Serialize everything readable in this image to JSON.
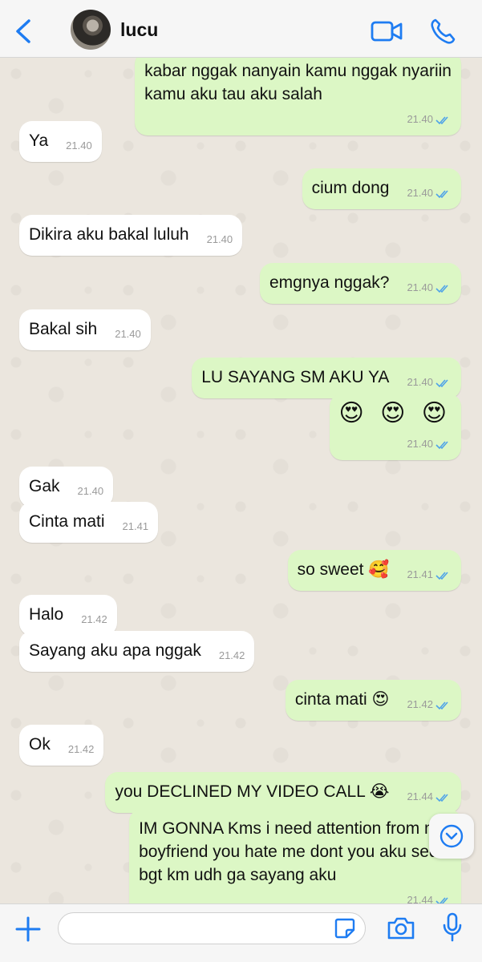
{
  "header": {
    "contact_name": "lucu",
    "back_icon": "chevron-left-icon",
    "video_icon": "video-camera-icon",
    "call_icon": "phone-icon"
  },
  "colors": {
    "accent": "#1e7cf2",
    "outgoing_bubble": "#dcf7c5",
    "incoming_bubble": "#ffffff",
    "read_ticks": "#4fa3e8"
  },
  "messages": [
    {
      "dir": "out",
      "lines": [
        "kabar nggak nanyain kamu nggak nyariin",
        "kamu aku tau aku salah"
      ],
      "time": "21.40",
      "read": true
    },
    {
      "dir": "in",
      "text": "Ya",
      "time": "21.40"
    },
    {
      "dir": "out",
      "text": "cium dong",
      "time": "21.40",
      "read": true
    },
    {
      "dir": "in",
      "text": "Dikira aku bakal luluh",
      "time": "21.40"
    },
    {
      "dir": "out",
      "text": "emgnya nggak?",
      "time": "21.40",
      "read": true
    },
    {
      "dir": "in",
      "text": "Bakal sih",
      "time": "21.40"
    },
    {
      "dir": "out",
      "text": "LU SAYANG SM AKU YA",
      "time": "21.40",
      "read": true
    },
    {
      "dir": "out",
      "text": "😍 😍 😍",
      "time": "21.40",
      "read": true
    },
    {
      "dir": "in",
      "text": "Gak",
      "time": "21.40"
    },
    {
      "dir": "in",
      "text": "Cinta mati",
      "time": "21.41"
    },
    {
      "dir": "out",
      "text": "so sweet 🥰",
      "time": "21.41",
      "read": true
    },
    {
      "dir": "in",
      "text": "Halo",
      "time": "21.42"
    },
    {
      "dir": "in",
      "text": "Sayang aku apa nggak",
      "time": "21.42"
    },
    {
      "dir": "out",
      "text": "cinta mati 😍",
      "time": "21.42",
      "read": true
    },
    {
      "dir": "in",
      "text": "Ok",
      "time": "21.42"
    },
    {
      "dir": "out",
      "text": "you DECLINED MY VIDEO CALL 😭",
      "time": "21.44",
      "read": true
    },
    {
      "dir": "out",
      "lines": [
        "IM GONNA Kms i need attention from my",
        "boyfriend you hate me dont you aku sedih",
        "bgt km udh ga sayang aku"
      ],
      "time": "21.44",
      "read": true
    }
  ],
  "composer": {
    "placeholder": "",
    "value": ""
  }
}
